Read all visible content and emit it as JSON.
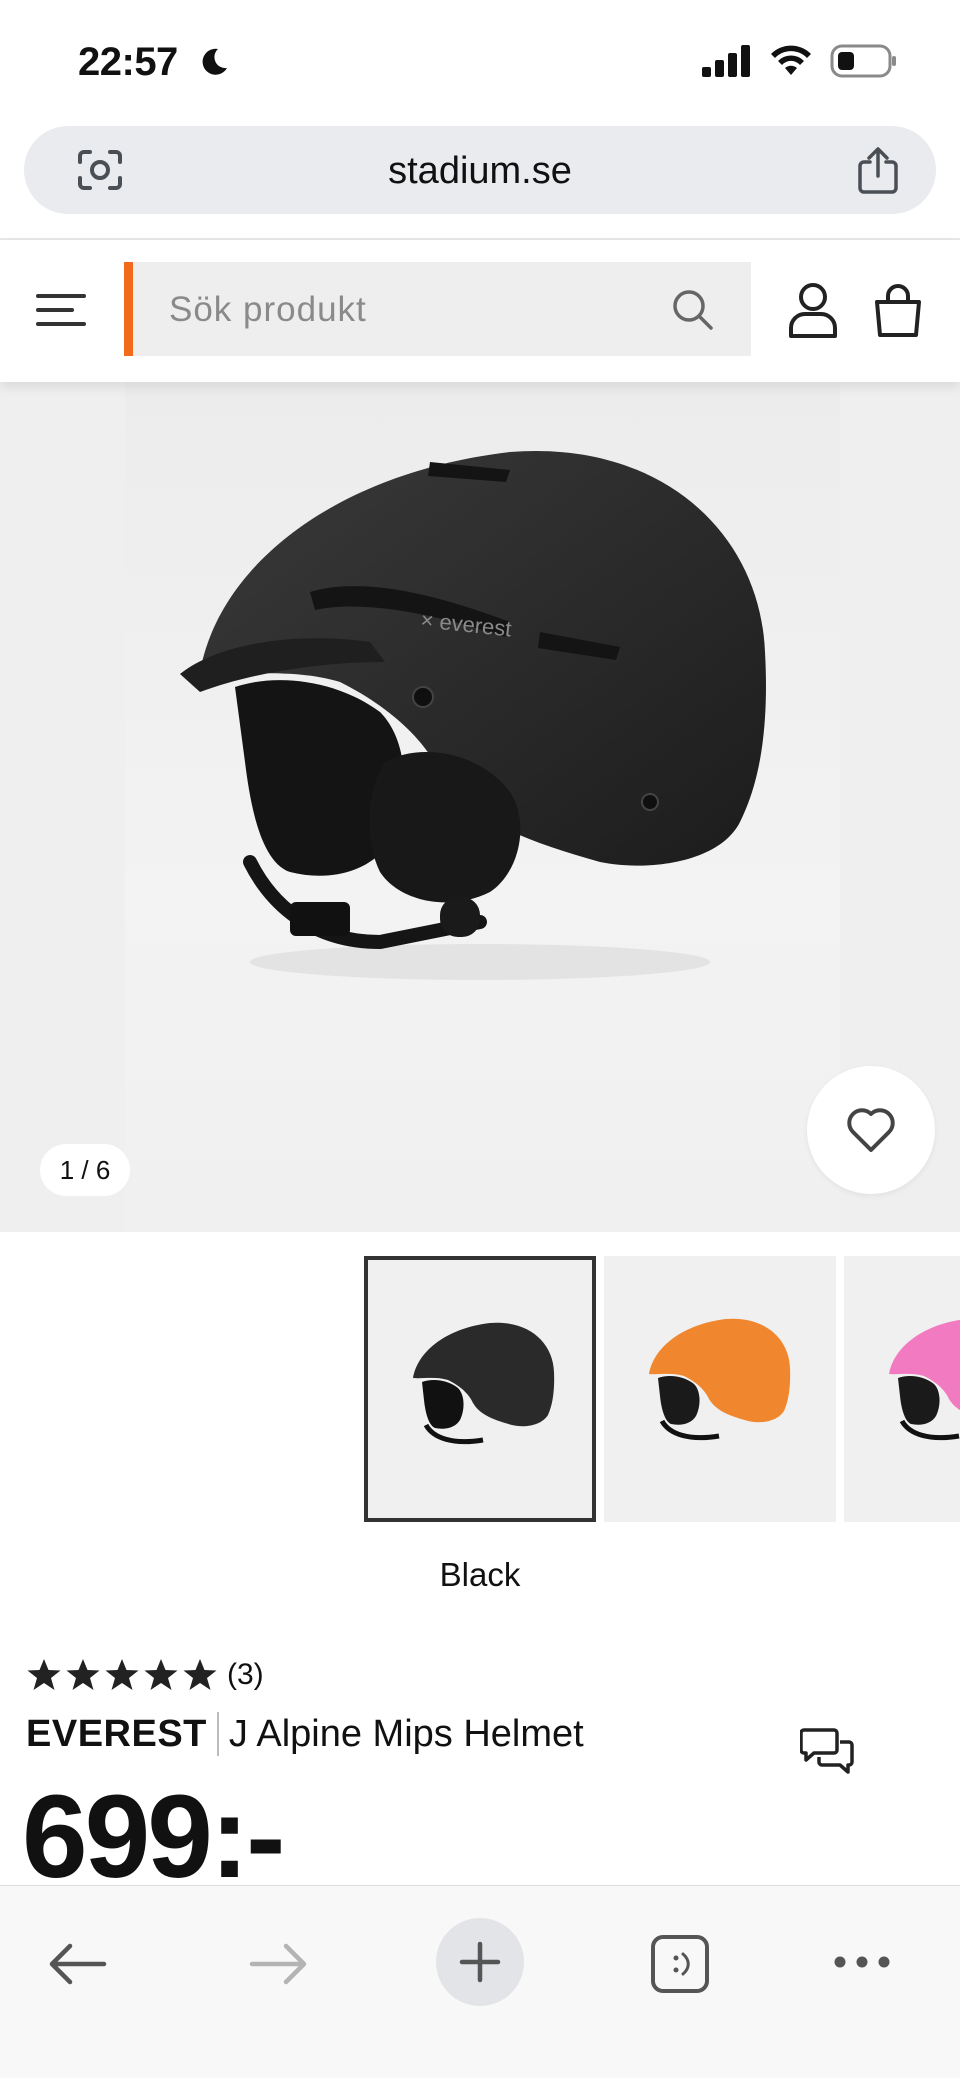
{
  "status_bar": {
    "time": "22:57",
    "icons": [
      "moon-icon",
      "cellular-signal-icon",
      "wifi-icon",
      "battery-icon"
    ]
  },
  "browser": {
    "url": "stadium.se",
    "icons": [
      "visual-search-icon",
      "share-icon"
    ]
  },
  "site_header": {
    "search_placeholder": "Sök produkt",
    "accent_color": "#f26a1b",
    "icons": [
      "hamburger-menu-icon",
      "search-icon",
      "account-icon",
      "cart-icon"
    ]
  },
  "gallery": {
    "counter": "1 / 6",
    "selected_color": "Black",
    "thumbnails": [
      {
        "color_name": "Black",
        "swatch": "#2a2a2a",
        "selected": true
      },
      {
        "color_name": "Orange",
        "swatch": "#f0872e",
        "selected": false
      },
      {
        "color_name": "Pink",
        "swatch": "#f27ac0",
        "selected": false
      }
    ]
  },
  "product": {
    "rating_stars": 5,
    "rating_count": "(3)",
    "brand": "EVEREST",
    "name": "J Alpine Mips Helmet",
    "price": "699:-"
  },
  "bottom_bar": {
    "icons": [
      "back-arrow-icon",
      "forward-arrow-icon",
      "plus-icon",
      "tabs-icon",
      "more-icon"
    ]
  }
}
